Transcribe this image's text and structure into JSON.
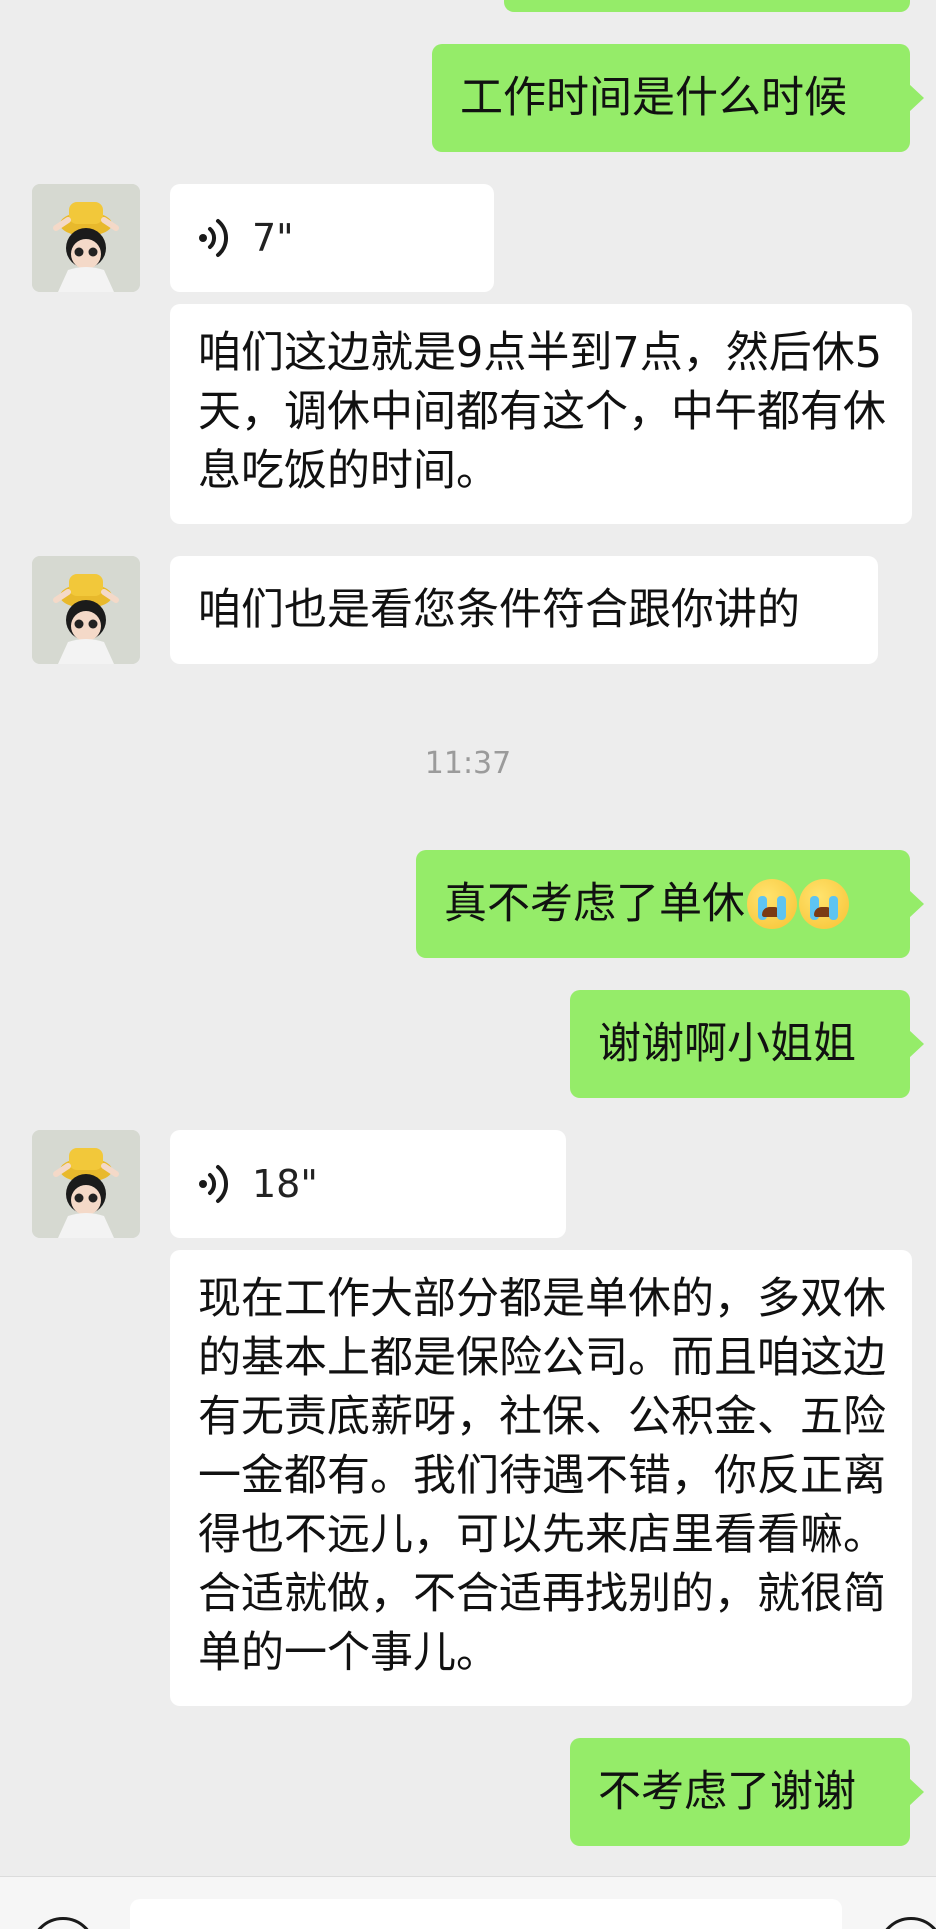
{
  "messages": {
    "m1": "工作时间是什么时候",
    "voice1": "7\"",
    "m2": "咱们这边就是9点半到7点，然后休5天，调休中间都有这个，中午都有休息吃饭的时间。",
    "m3": "咱们也是看您条件符合跟你讲的",
    "time": "11:37",
    "m4": "真不考虑了单休",
    "m5": "谢谢啊小姐姐",
    "voice2": "18\"",
    "m6": "现在工作大部分都是单休的，多双休的基本上都是保险公司。而且咱这边有无责底薪呀，社保、公积金、五险一金都有。我们待遇不错，你反正离得也不远儿，可以先来店里看看嘛。合适就做，不合适再找别的，就很简单的一个事儿。",
    "m7": "不考虑了谢谢"
  },
  "m4_emojis": [
    "loudly-crying-face",
    "loudly-crying-face"
  ],
  "colors": {
    "outgoing_bubble": "#95ec69",
    "incoming_bubble": "#ffffff",
    "background": "#ededed"
  }
}
